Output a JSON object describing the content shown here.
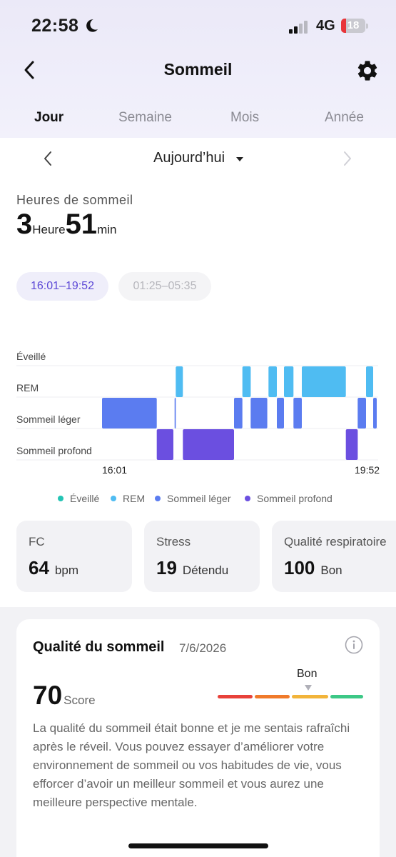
{
  "status_bar": {
    "time": "22:58",
    "network": "4G",
    "battery": "18"
  },
  "header": {
    "title": "Sommeil"
  },
  "tabs": [
    {
      "label": "Jour",
      "active": true
    },
    {
      "label": "Semaine",
      "active": false
    },
    {
      "label": "Mois",
      "active": false
    },
    {
      "label": "Année",
      "active": false
    }
  ],
  "date_nav": {
    "label": "Aujourd’hui"
  },
  "sleep_hours": {
    "label": "Heures de sommeil",
    "hours": "3",
    "hours_unit": "Heure",
    "minutes": "51",
    "minutes_unit": "min"
  },
  "periods": [
    {
      "label": "16:01–19:52",
      "selected": true
    },
    {
      "label": "01:25–05:35",
      "selected": false
    }
  ],
  "chart_data": {
    "type": "timeline",
    "stages": [
      "Éveillé",
      "REM",
      "Sommeil léger",
      "Sommeil profond"
    ],
    "colors": {
      "Éveillé": "#23c4b4",
      "REM": "#4fbcf2",
      "Sommeil léger": "#5b7cf0",
      "Sommeil profond": "#6b4fe0"
    },
    "x_start_label": "16:01",
    "x_end_label": "19:52",
    "total_minutes": 231,
    "segments": [
      {
        "stage": "Sommeil léger",
        "start": 0,
        "end": 46
      },
      {
        "stage": "Sommeil profond",
        "start": 46,
        "end": 60
      },
      {
        "stage": "Sommeil léger",
        "start": 61,
        "end": 62
      },
      {
        "stage": "REM",
        "start": 62,
        "end": 68
      },
      {
        "stage": "Sommeil profond",
        "start": 68,
        "end": 111
      },
      {
        "stage": "Sommeil léger",
        "start": 111,
        "end": 118
      },
      {
        "stage": "REM",
        "start": 118,
        "end": 125
      },
      {
        "stage": "Sommeil léger",
        "start": 125,
        "end": 139
      },
      {
        "stage": "REM",
        "start": 140,
        "end": 147
      },
      {
        "stage": "Sommeil léger",
        "start": 147,
        "end": 153
      },
      {
        "stage": "REM",
        "start": 153,
        "end": 161
      },
      {
        "stage": "Sommeil léger",
        "start": 161,
        "end": 168
      },
      {
        "stage": "REM",
        "start": 168,
        "end": 205
      },
      {
        "stage": "Sommeil profond",
        "start": 205,
        "end": 215
      },
      {
        "stage": "Sommeil léger",
        "start": 215,
        "end": 222
      },
      {
        "stage": "REM",
        "start": 222,
        "end": 228
      },
      {
        "stage": "Sommeil léger",
        "start": 228,
        "end": 231
      }
    ]
  },
  "legend": [
    {
      "label": "Éveillé",
      "color": "#23c4b4"
    },
    {
      "label": "REM",
      "color": "#4fbcf2"
    },
    {
      "label": "Sommeil léger",
      "color": "#5b7cf0"
    },
    {
      "label": "Sommeil profond",
      "color": "#6b4fe0"
    }
  ],
  "metrics": [
    {
      "label": "FC",
      "value": "64",
      "unit": "bpm"
    },
    {
      "label": "Stress",
      "value": "19",
      "unit": "Détendu"
    },
    {
      "label": "Qualité respiratoire",
      "value": "100",
      "unit": "Bon"
    }
  ],
  "quality": {
    "title": "Qualité du sommeil",
    "date": "7/6/2026",
    "score": "70",
    "score_label": "Score",
    "rating": "Bon",
    "scale_colors": [
      "#e8413a",
      "#f07a2a",
      "#f2b43a",
      "#3cc886"
    ],
    "text": "La qualité du sommeil était bonne et je me sentais rafraîchi après le réveil. Vous pouvez essayer d’améliorer votre environnement de sommeil ou vos habitudes de vie, vous efforcer d’avoir un meilleur sommeil et vous aurez une meilleure perspective mentale."
  },
  "icons": {
    "back": "chevron-left-icon",
    "settings": "gear-icon",
    "moon": "moon-icon",
    "prev": "chevron-left-icon",
    "next": "chevron-right-icon",
    "info": "info-icon",
    "caret": "caret-down-icon"
  }
}
